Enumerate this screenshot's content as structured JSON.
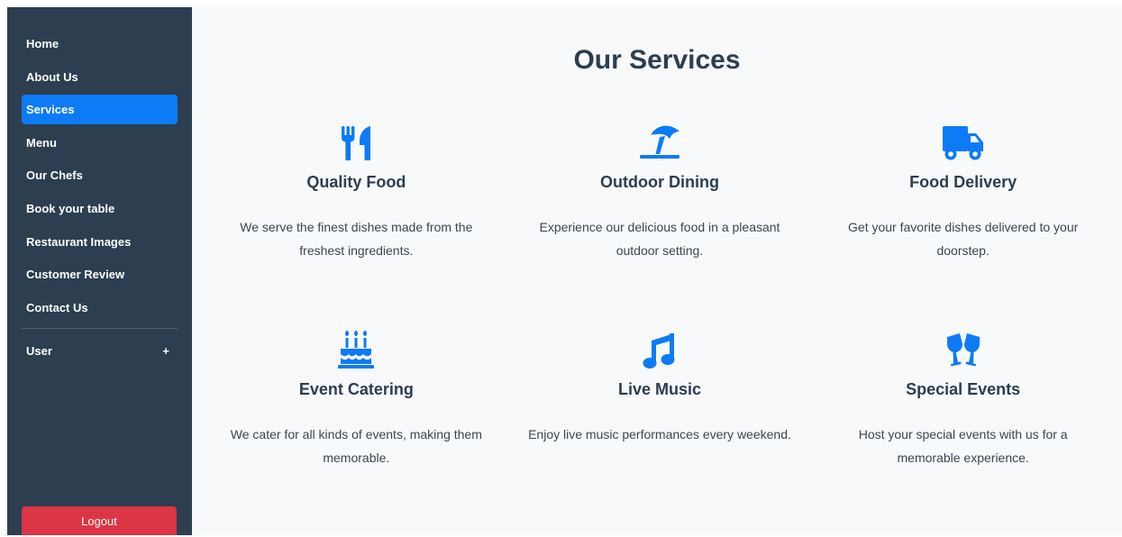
{
  "sidebar": {
    "items": [
      {
        "label": "Home"
      },
      {
        "label": "About Us"
      },
      {
        "label": "Services"
      },
      {
        "label": "Menu"
      },
      {
        "label": "Our Chefs"
      },
      {
        "label": "Book your table"
      },
      {
        "label": "Restaurant Images"
      },
      {
        "label": "Customer Review"
      },
      {
        "label": "Contact Us"
      }
    ],
    "active_item": "Services",
    "user_label": "User",
    "user_toggle": "+",
    "logout_label": "Logout"
  },
  "main": {
    "title": "Our Services",
    "services": [
      {
        "icon": "utensils-icon",
        "title": "Quality Food",
        "text": "We serve the finest dishes made from the freshest ingredients."
      },
      {
        "icon": "umbrella-beach-icon",
        "title": "Outdoor Dining",
        "text": "Experience our delicious food in a pleasant outdoor setting."
      },
      {
        "icon": "truck-icon",
        "title": "Food Delivery",
        "text": "Get your favorite dishes delivered to your doorstep."
      },
      {
        "icon": "birthday-cake-icon",
        "title": "Event Catering",
        "text": "We cater for all kinds of events, making them memorable."
      },
      {
        "icon": "music-icon",
        "title": "Live Music",
        "text": "Enjoy live music performances every weekend."
      },
      {
        "icon": "glass-cheers-icon",
        "title": "Special Events",
        "text": "Host your special events with us for a memorable experience."
      }
    ]
  },
  "colors": {
    "sidebar_bg": "#2c3e50",
    "active_bg": "#0d7bf5",
    "logout_bg": "#dc3545",
    "icon_blue": "#0d7bf5",
    "heading": "#2c3e50",
    "main_bg": "#f8f9fa"
  }
}
